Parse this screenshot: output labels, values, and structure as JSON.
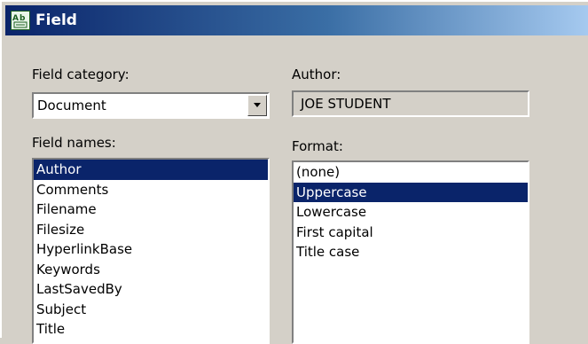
{
  "window": {
    "title": "Field",
    "icon": "field-app-icon"
  },
  "field_category": {
    "label": "Field category:",
    "selected": "Document",
    "dropdown_icon": "chevron-down-icon"
  },
  "author": {
    "label": "Author:",
    "value": "JOE STUDENT"
  },
  "field_names": {
    "label": "Field names:",
    "items": [
      {
        "label": "Author",
        "selected": true
      },
      {
        "label": "Comments",
        "selected": false
      },
      {
        "label": "Filename",
        "selected": false
      },
      {
        "label": "Filesize",
        "selected": false
      },
      {
        "label": "HyperlinkBase",
        "selected": false
      },
      {
        "label": "Keywords",
        "selected": false
      },
      {
        "label": "LastSavedBy",
        "selected": false
      },
      {
        "label": "Subject",
        "selected": false
      },
      {
        "label": "Title",
        "selected": false
      }
    ]
  },
  "format": {
    "label": "Format:",
    "items": [
      {
        "label": "(none)",
        "selected": false
      },
      {
        "label": "Uppercase",
        "selected": true
      },
      {
        "label": "Lowercase",
        "selected": false
      },
      {
        "label": "First capital",
        "selected": false
      },
      {
        "label": "Title case",
        "selected": false
      }
    ]
  },
  "colors": {
    "dialog_bg": "#d4d0c8",
    "selection_bg": "#0a246a",
    "title_gradient_start": "#0a246a"
  }
}
